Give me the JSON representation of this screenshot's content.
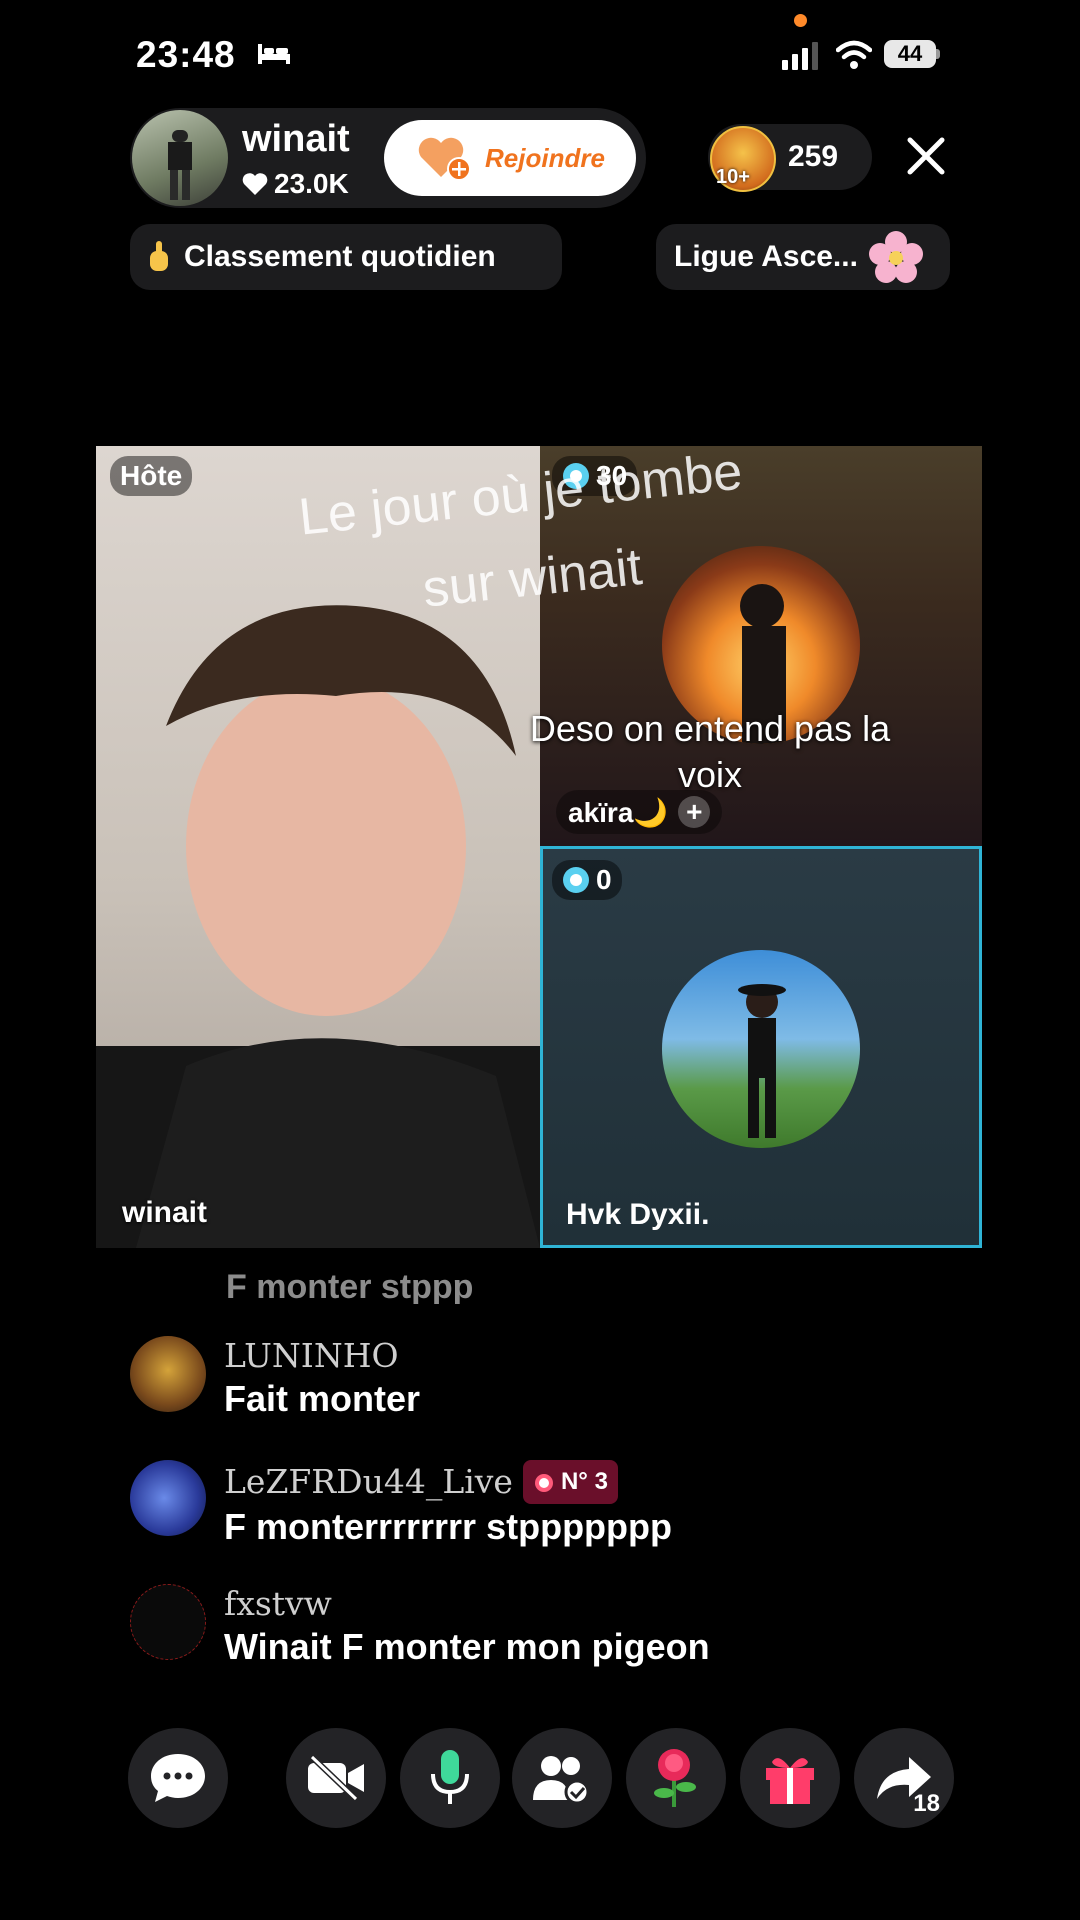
{
  "status_bar": {
    "time": "23:48",
    "battery": "44"
  },
  "host": {
    "name": "winait",
    "likes": "23.0K",
    "join_label": "Rejoindre"
  },
  "viewers": {
    "badge": "10+",
    "count": "259"
  },
  "badges": {
    "daily_ranking": "Classement quotidien",
    "league": "Ligue Asce..."
  },
  "video_grid": {
    "host_tag": "Hôte",
    "host_name": "winait",
    "guest1": {
      "score": "30",
      "name": "akïra🌙"
    },
    "guest2": {
      "score": "0",
      "name": "Hvk Dyxii."
    }
  },
  "captions": {
    "line1": "Le jour où je tombe",
    "line2": "sur winait",
    "line3": "Deso on entend pas la voix"
  },
  "comments": {
    "faded_text": "F monter stppp",
    "items": [
      {
        "user": "LUNINHO",
        "text": "Fait monter"
      },
      {
        "user": "LeZFRDu44_Live",
        "badge": "N° 3",
        "text": "F monterrrrrrrr stppppppp"
      },
      {
        "user": "fxstvw",
        "text": "Winait F monter mon pigeon"
      }
    ]
  },
  "bottom_bar": {
    "share_count": "18"
  },
  "colors": {
    "join_orange": "#f0731e",
    "active_tile_border": "#2fb4d6",
    "rank_badge": "#6a0f2a"
  }
}
